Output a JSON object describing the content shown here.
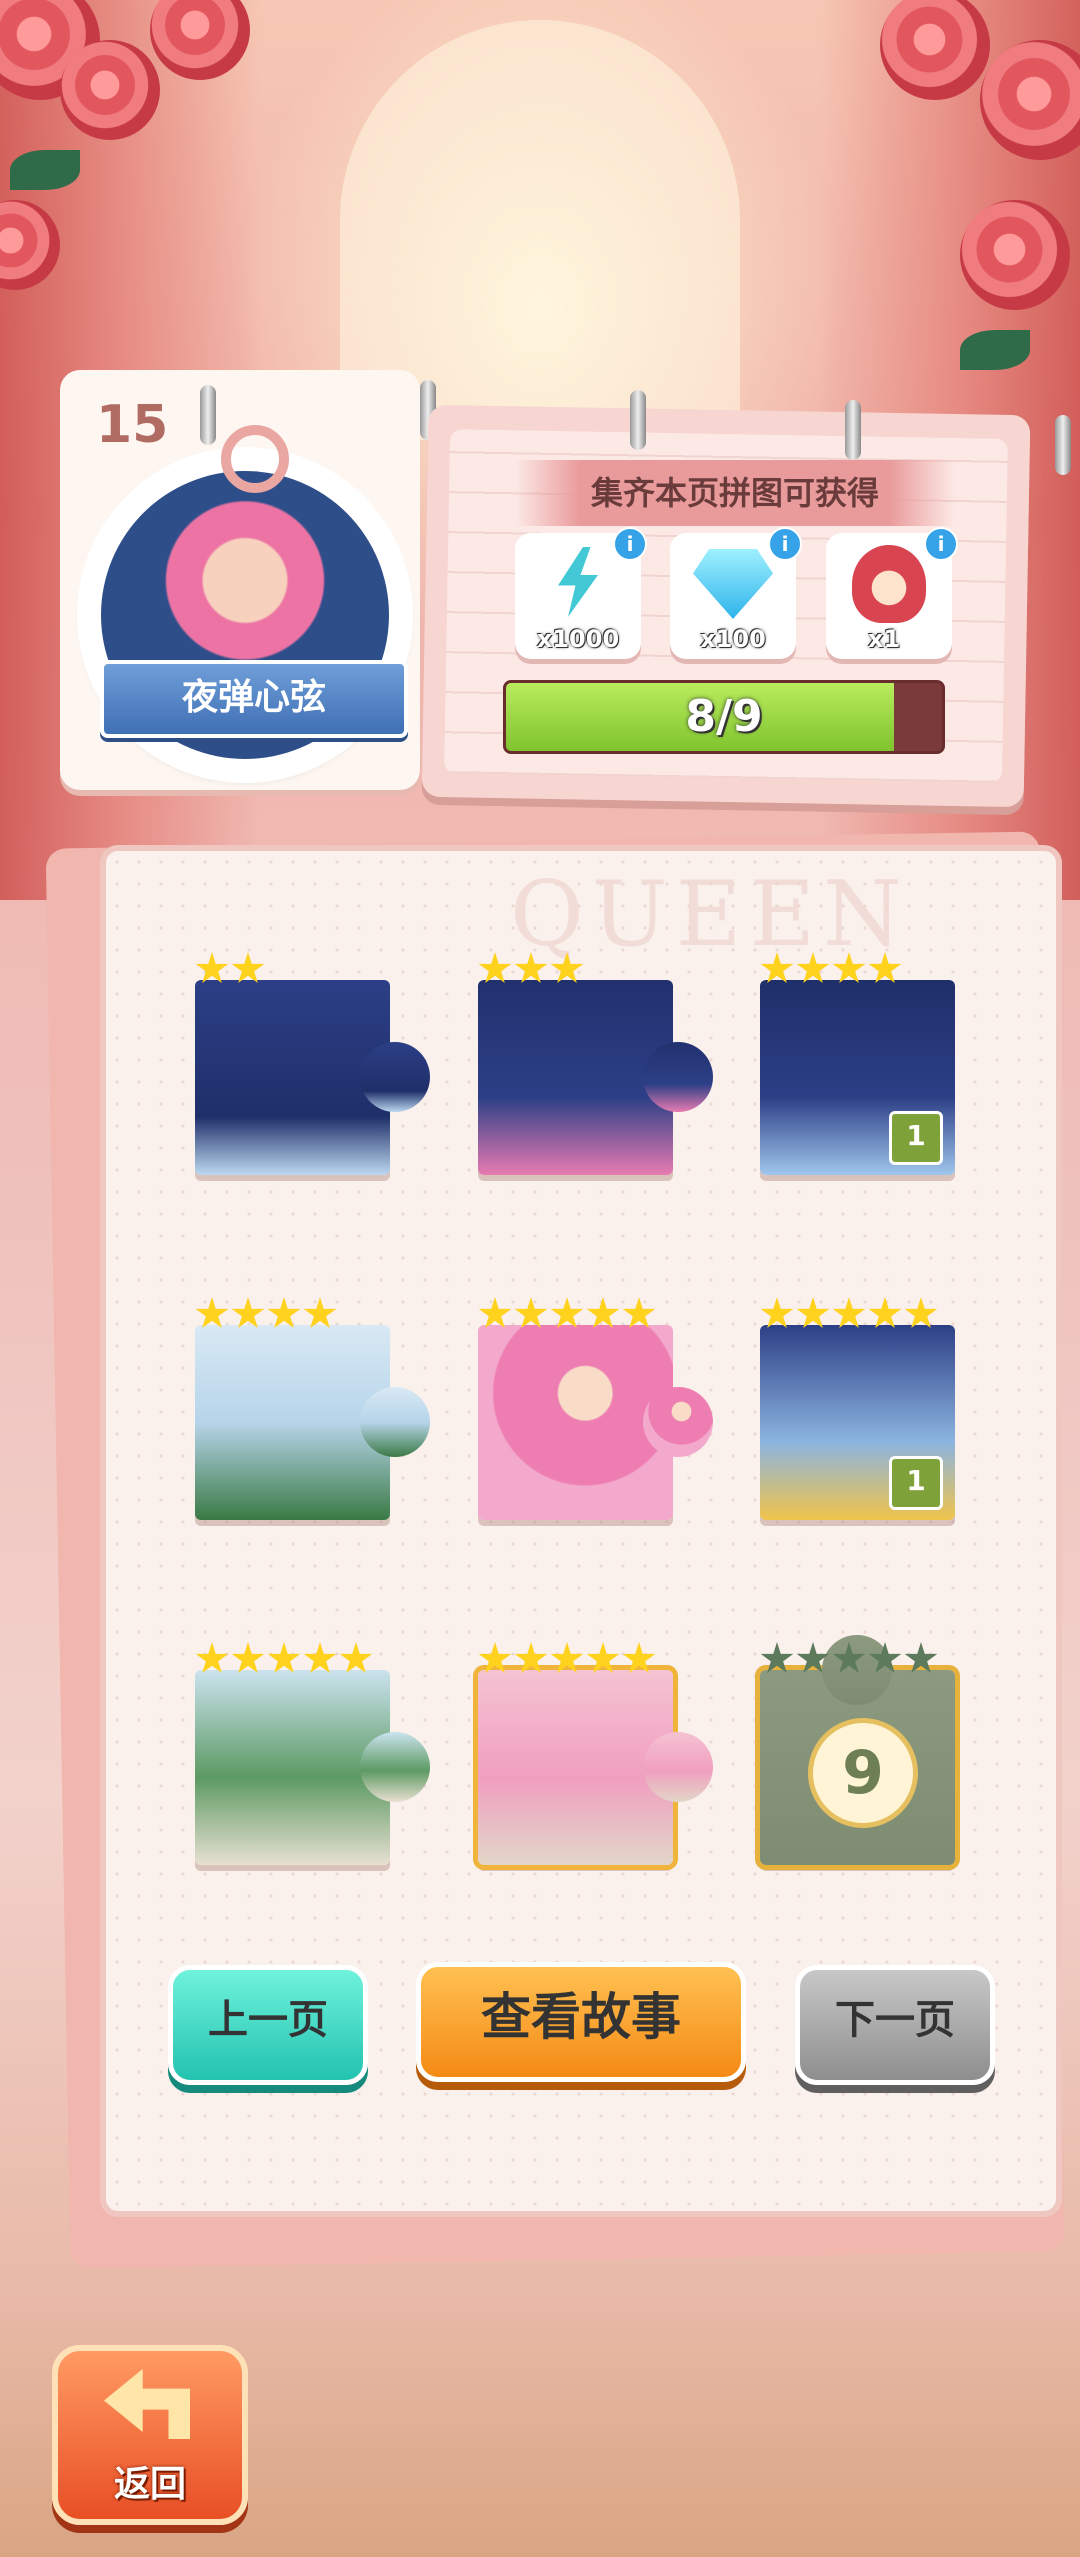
{
  "album": {
    "page_number": "15",
    "title": "夜弹心弦"
  },
  "rewards": {
    "title": "集齐本页拼图可获得",
    "info_label": "i",
    "items": [
      {
        "icon": "energy-bolt-icon",
        "qty": "x1000"
      },
      {
        "icon": "diamond-icon",
        "qty": "x100"
      },
      {
        "icon": "jester-character-icon",
        "qty": "x1"
      }
    ],
    "progress": {
      "text": "8/9",
      "collected": 8,
      "total": 9
    }
  },
  "board": {
    "watermark": "QUEEN",
    "pieces": [
      {
        "stars": 2,
        "badge": "",
        "collected": true
      },
      {
        "stars": 3,
        "badge": "",
        "collected": true
      },
      {
        "stars": 4,
        "badge": "1",
        "collected": true
      },
      {
        "stars": 4,
        "badge": "",
        "collected": true
      },
      {
        "stars": 5,
        "badge": "",
        "collected": true
      },
      {
        "stars": 5,
        "badge": "1",
        "collected": true
      },
      {
        "stars": 5,
        "badge": "",
        "collected": true
      },
      {
        "stars": 5,
        "badge": "",
        "collected": true
      },
      {
        "stars": 5,
        "badge": "",
        "collected": false,
        "number": "9"
      }
    ]
  },
  "buttons": {
    "prev": "上一页",
    "story": "查看故事",
    "next": "下一页",
    "back": "返回"
  },
  "colors": {
    "prev_button": "#22c3b0",
    "story_button": "#f58a15",
    "next_button": "#8e8e8e",
    "star": "#ffd21e",
    "progress_fill": "#7fc42f"
  }
}
